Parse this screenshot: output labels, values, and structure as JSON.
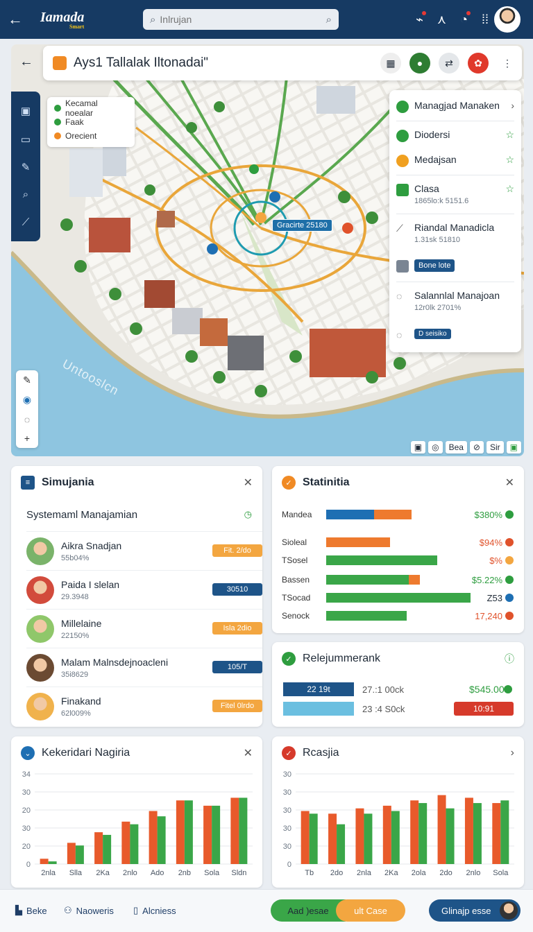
{
  "app": {
    "logo_text": "Iamada",
    "logo_tag": "Smart",
    "search_placeholder": "Inlrujan"
  },
  "map": {
    "title": "Ays1 Tallalak Iltonadai\"",
    "legend": [
      {
        "label": "Kecamal noealar",
        "color": "#2e9d3f"
      },
      {
        "label": "Faak",
        "color": "#2e9d3f"
      },
      {
        "label": "Orecient",
        "color": "#f08a24"
      }
    ],
    "poi_label": "Gracirte 25180",
    "water_label": "Untooslcn",
    "footer": [
      "Bea",
      "Sir"
    ],
    "layers": [
      {
        "name": "Managjad Manaken",
        "sub": "",
        "color": "#2e9d3f",
        "action": "›"
      },
      {
        "name": "Diodersi",
        "sub": "",
        "color": "#2e9d3f",
        "action": "☆"
      },
      {
        "name": "Medajsan",
        "sub": "",
        "color": "#f0a020",
        "action": "☆"
      },
      {
        "name": "Clasa",
        "sub": "1865lo:k 5151.6",
        "color": "#2e9d3f",
        "action": "☆"
      },
      {
        "name": "Riandal Manadicla",
        "sub": "1.31sk 51810",
        "color": "#7a8593",
        "action": ""
      },
      {
        "name": "Salannlal Manajoan",
        "sub": "12r0lk 2701%",
        "color": "#7a8593",
        "action": ""
      }
    ],
    "chip1": "Bone lote",
    "chip2": "D seisiko"
  },
  "sim": {
    "title": "Simujania",
    "subtitle": "Systemaml Manajamian",
    "people": [
      {
        "name": "Aikra Snadjan",
        "sub": "55b04%",
        "badge": "Fit. 2/do",
        "color": "#f3a640",
        "av": "#7ab36a"
      },
      {
        "name": "Paida I slelan",
        "sub": "29.3948",
        "badge": "30510",
        "color": "#1e5488",
        "av": "#d24b3c"
      },
      {
        "name": "Millelaine",
        "sub": "22150%",
        "badge": "Isla 2dio",
        "color": "#f3a640",
        "av": "#8fc76a"
      },
      {
        "name": "Malam Malnsdejnoacleni",
        "sub": "35i8629",
        "badge": "105/T",
        "color": "#1e5488",
        "av": "#6b4a32"
      },
      {
        "name": "Finakand",
        "sub": "62l009%",
        "badge": "Fitel 0lrdo",
        "color": "#f3a640",
        "av": "#f0b24c"
      }
    ]
  },
  "stats": {
    "title": "Statinitia",
    "rows": [
      {
        "label": "Mandea",
        "value": "$380%",
        "value_color": "#2e9d3f",
        "dot": "#2e9d3f",
        "segments": [
          {
            "w": 0.33,
            "c": "#1e6fb3"
          },
          {
            "w": 0.26,
            "c": "#ee7a2e"
          }
        ]
      },
      {
        "label": "Sioleal",
        "value": "$94%",
        "value_color": "#e0522b",
        "dot": "#e0522b",
        "segments": [
          {
            "w": 0.44,
            "c": "#ee7a2e"
          }
        ]
      },
      {
        "label": "TSosel",
        "value": "$%",
        "value_color": "#e0522b",
        "dot": "#f3a640",
        "segments": [
          {
            "w": 0.77,
            "c": "#3aa648"
          }
        ]
      },
      {
        "label": "Bassen",
        "value": "$5.22%",
        "value_color": "#2e9d3f",
        "dot": "#2e9d3f",
        "segments": [
          {
            "w": 0.57,
            "c": "#3aa648"
          },
          {
            "w": 0.08,
            "c": "#ee7a2e"
          }
        ]
      },
      {
        "label": "TSocad",
        "value": "Z53",
        "value_color": "#1f2a37",
        "dot": "#1e6fb3",
        "segments": [
          {
            "w": 1.0,
            "c": "#3aa648"
          }
        ]
      },
      {
        "label": "Senock",
        "value": "17,240",
        "value_color": "#e0522b",
        "dot": "#e0522b",
        "segments": [
          {
            "w": 0.56,
            "c": "#3aa648"
          }
        ]
      }
    ]
  },
  "rel": {
    "title": "Relejummerank",
    "bar1_label": "22 19t",
    "bar1_text": "27.:1 00ck",
    "bar1_value": "$545.00",
    "bar2_text": "23 :4 S0ck",
    "bar2_badge": "10:91"
  },
  "chart_left": {
    "title": "Kekeridari Nagiria"
  },
  "chart_right": {
    "title": "Rcasjia"
  },
  "chart_data": [
    {
      "type": "bar",
      "title": "Kekeridari Nagiria",
      "categories": [
        "2nla",
        "Slla",
        "2Ka",
        "2nlo",
        "Ado",
        "2nb",
        "Sola",
        "Sldn"
      ],
      "yticks": [
        0,
        20,
        30,
        20,
        30,
        34
      ],
      "ylim": [
        0,
        34
      ],
      "series": [
        {
          "color": "#e85a2b",
          "values": [
            2,
            8,
            12,
            16,
            20,
            24,
            22,
            25
          ]
        },
        {
          "color": "#3aa648",
          "values": [
            1,
            7,
            11,
            15,
            18,
            24,
            22,
            25
          ]
        },
        {
          "color": "#1e6fb3",
          "values": [
            0,
            0,
            0,
            0,
            0,
            0,
            0,
            0
          ]
        }
      ]
    },
    {
      "type": "bar",
      "title": "Rcasjia",
      "categories": [
        "Tb",
        "2do",
        "2nla",
        "2Ka",
        "2ola",
        "2do",
        "2nlo",
        "Sola"
      ],
      "yticks": [
        0,
        30,
        30,
        30,
        30,
        30
      ],
      "ylim": [
        0,
        34
      ],
      "series": [
        {
          "color": "#e85a2b",
          "values": [
            20,
            19,
            21,
            22,
            24,
            26,
            25,
            23
          ]
        },
        {
          "color": "#3aa648",
          "values": [
            19,
            15,
            19,
            20,
            23,
            21,
            23,
            24
          ]
        }
      ]
    }
  ],
  "nav": {
    "item1": "Beke",
    "item2": "Naoweris",
    "item3": "Alcniess",
    "pill_green": "Aad )esae",
    "pill_orange": "ult Case",
    "pill_blue": "Glinajp esse"
  }
}
